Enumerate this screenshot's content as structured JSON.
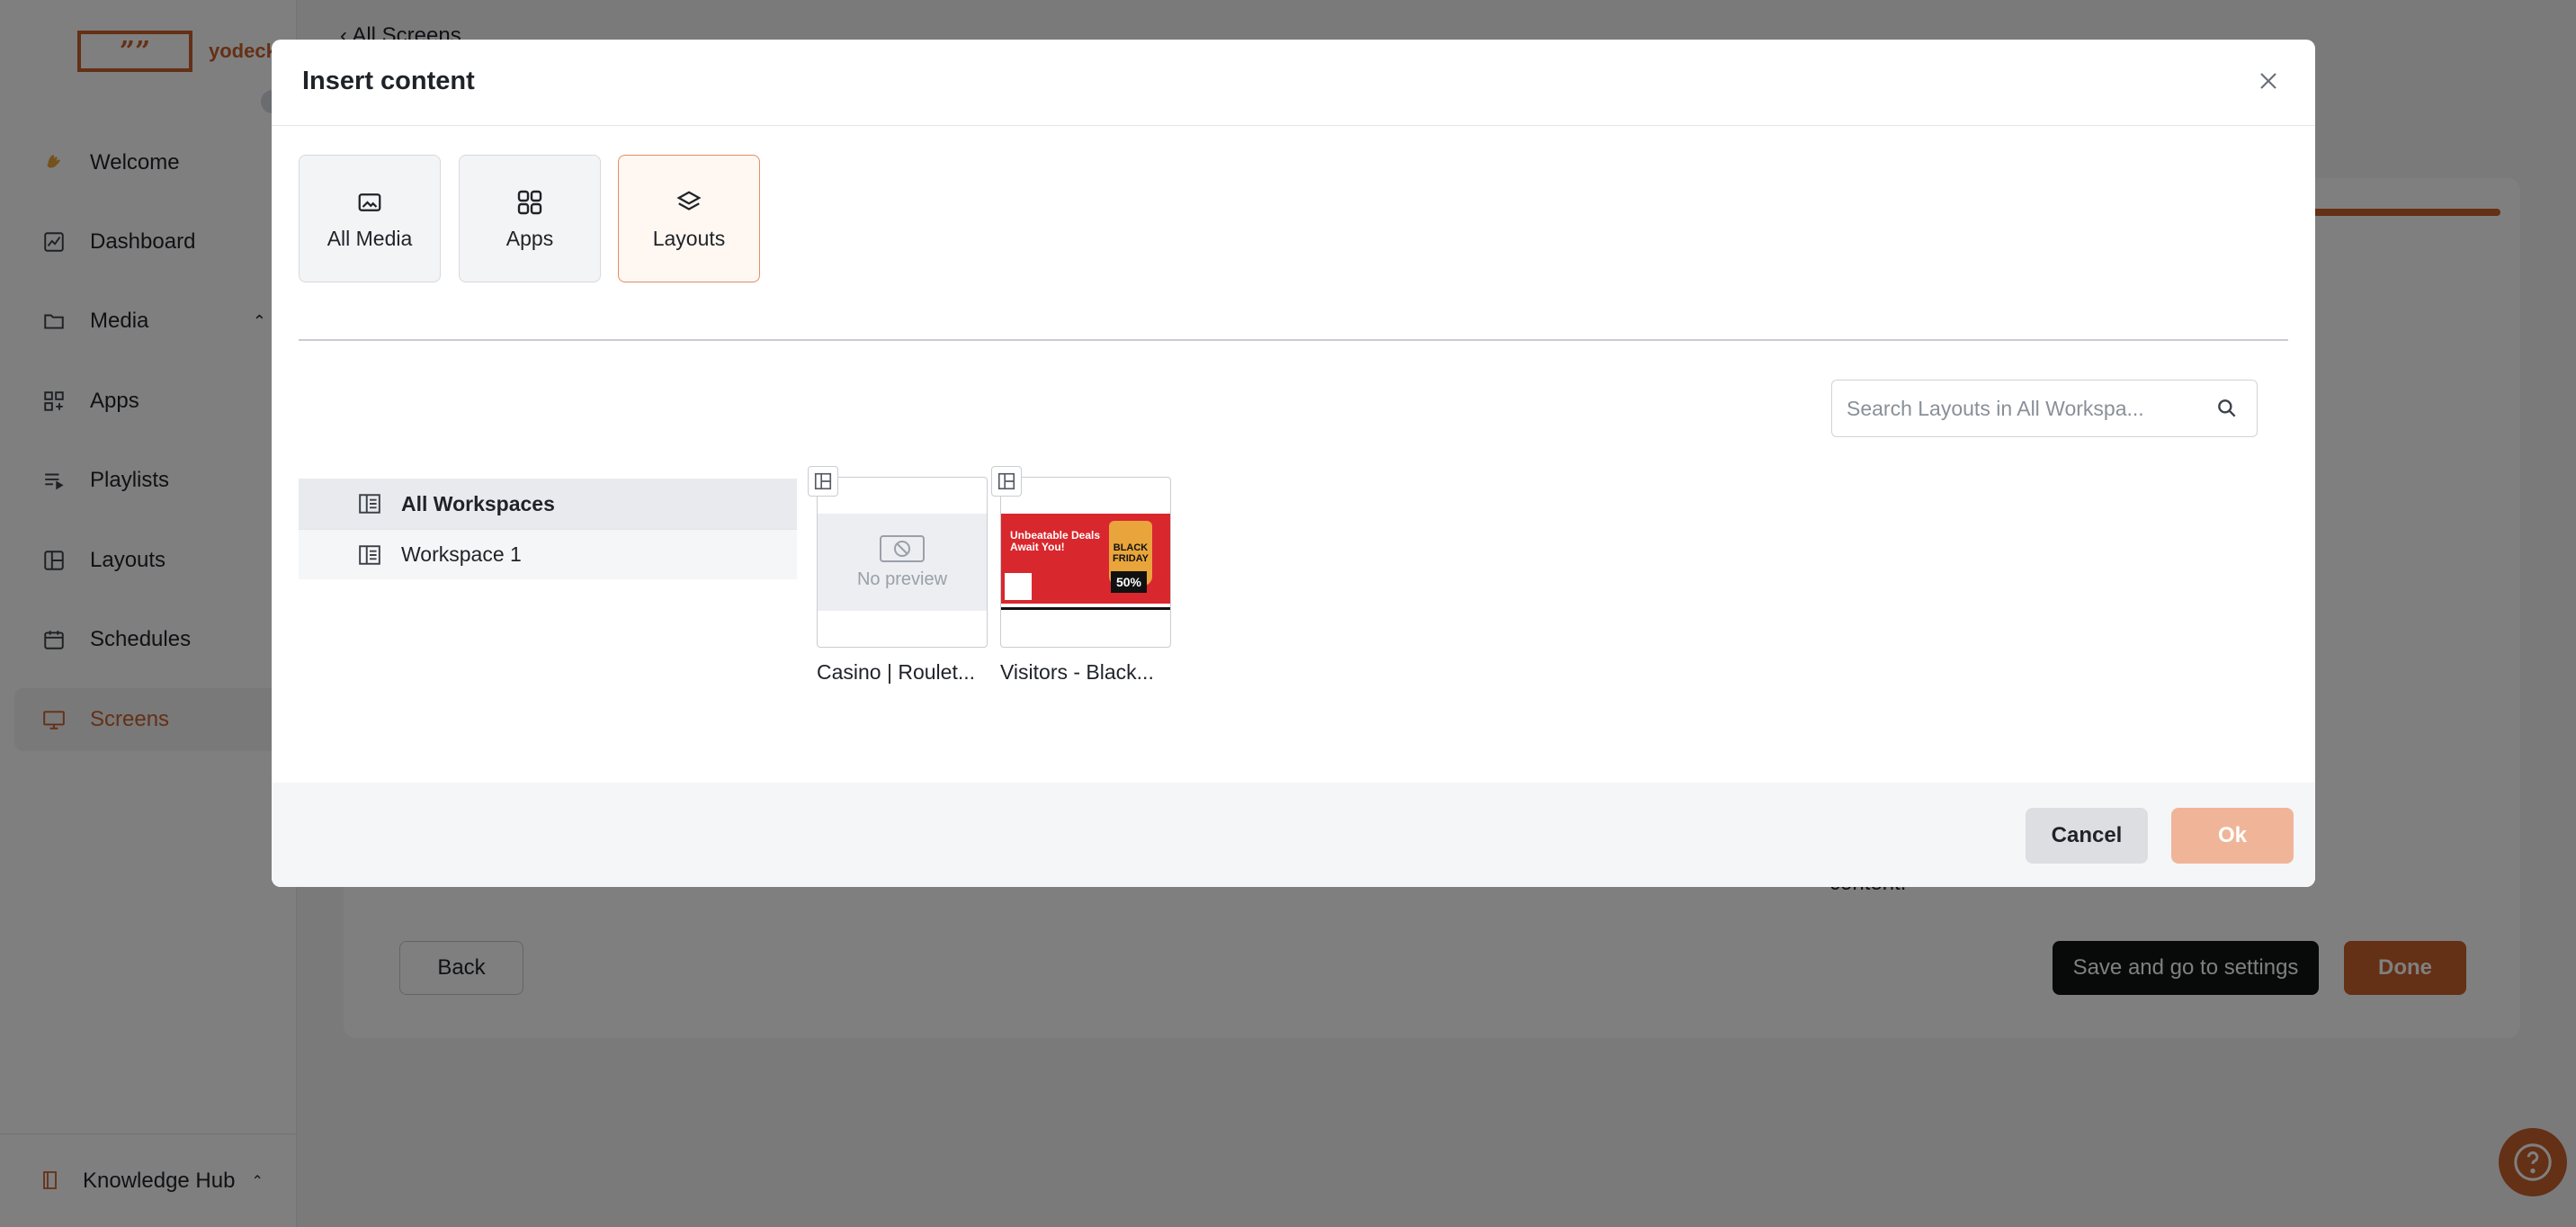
{
  "app": {
    "logo_mark": "””",
    "logo_text": "yodeck",
    "nav": [
      {
        "label": "Welcome",
        "icon": "hand-wave-icon"
      },
      {
        "label": "Dashboard",
        "icon": "chart-icon"
      },
      {
        "label": "Media",
        "icon": "folder-icon"
      },
      {
        "label": "Apps",
        "icon": "apps-icon"
      },
      {
        "label": "Playlists",
        "icon": "playlist-icon"
      },
      {
        "label": "Layouts",
        "icon": "layout-icon"
      },
      {
        "label": "Schedules",
        "icon": "calendar-icon"
      },
      {
        "label": "Screens",
        "icon": "monitor-icon",
        "active": true
      }
    ],
    "knowledge_hub": "Knowledge Hub",
    "back_link": "‹ All Screens",
    "content_hint": "content.",
    "back_button": "Back",
    "save_button": "Save and go to settings",
    "done_button": "Done",
    "accent_color": "#c8612d"
  },
  "modal": {
    "title": "Insert content",
    "tabs": [
      {
        "label": "All Media",
        "icon": "image-icon"
      },
      {
        "label": "Apps",
        "icon": "apps-grid-icon"
      },
      {
        "label": "Layouts",
        "icon": "layers-icon",
        "active": true
      }
    ],
    "search": {
      "placeholder": "Search Layouts in All Workspa...",
      "value": ""
    },
    "workspaces": [
      {
        "label": "All Workspaces",
        "selected": true
      },
      {
        "label": "Workspace 1",
        "selected": false
      }
    ],
    "layouts": [
      {
        "name": "Casino | Roulet...",
        "preview": "No preview"
      },
      {
        "name": "Visitors - Black...",
        "thumb_headline": "Unbeatable Deals Await You!",
        "thumb_tag": "BLACK FRIDAY",
        "thumb_percent": "50%"
      }
    ],
    "cancel": "Cancel",
    "ok": "Ok"
  }
}
